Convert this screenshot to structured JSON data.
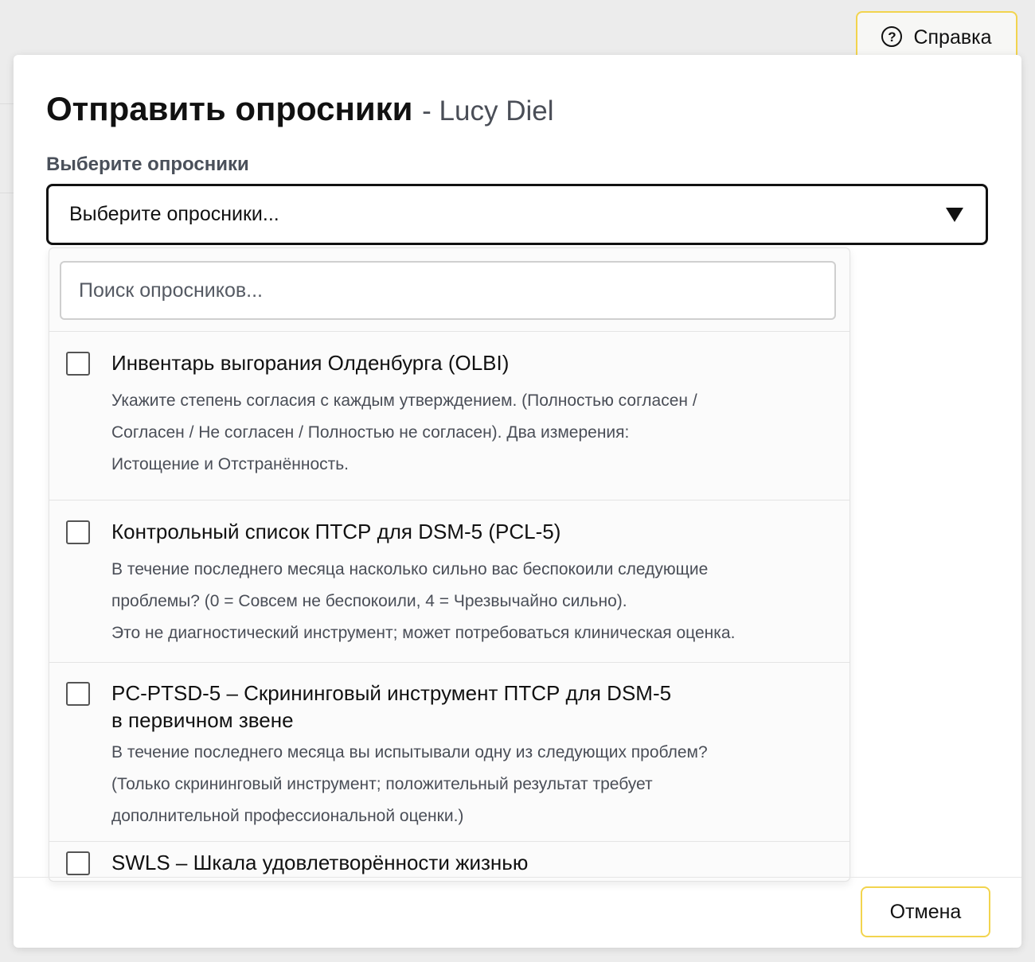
{
  "header": {
    "help_label": "Справка",
    "help_icon": "question-circle-icon"
  },
  "modal": {
    "title": "Отправить опросники",
    "subtitle": "- Lucy Diel",
    "select_label": "Выберите опросники",
    "select_value": "Выберите опросники...",
    "caret_icon": "caret-down-icon",
    "search_placeholder": "Поиск опросников...",
    "search_value": "",
    "items": [
      {
        "title": "Инвентарь выгорания Олденбурга (OLBI)",
        "title_lines": [
          "Инвентарь выгорания Олденбурга (OLBI)"
        ],
        "desc_lines": [
          "Укажите степень согласия с каждым утверждением. (Полностью согласен /",
          "Согласен / Не согласен / Полностью не согласен). Два измерения:",
          "Истощение и Отстранённость."
        ],
        "checked": false
      },
      {
        "title": "Контрольный список ПТСР для DSM-5 (PCL-5)",
        "title_lines": [
          "Контрольный список ПТСР для DSM-5 (PCL-5)"
        ],
        "desc_lines": [
          "В течение последнего месяца насколько сильно вас беспокоили следующие",
          "проблемы? (0 = Совсем не беспокоили, 4 = Чрезвычайно сильно).",
          "Это не диагностический инструмент; может потребоваться клиническая оценка."
        ],
        "checked": false
      },
      {
        "title_lines": [
          "PC-PTSD-5 – Скрининговый инструмент ПТСР для DSM-5",
          "в первичном звене"
        ],
        "desc_lines": [
          "В течение последнего месяца вы испытывали одну из следующих проблем?",
          "(Только скрининговый инструмент; положительный результат требует",
          "дополнительной профессиональной оценки.)"
        ],
        "checked": false
      },
      {
        "title_lines": [
          "SWLS – Шкала удовлетворённости жизнью"
        ],
        "desc_lines": [],
        "checked": false
      }
    ]
  },
  "footer": {
    "cancel_label": "Отмена"
  },
  "colors": {
    "accent_border": "#f2d44e",
    "backdrop": "#ececec",
    "text_primary": "#111111",
    "text_secondary": "#4a4e57"
  }
}
